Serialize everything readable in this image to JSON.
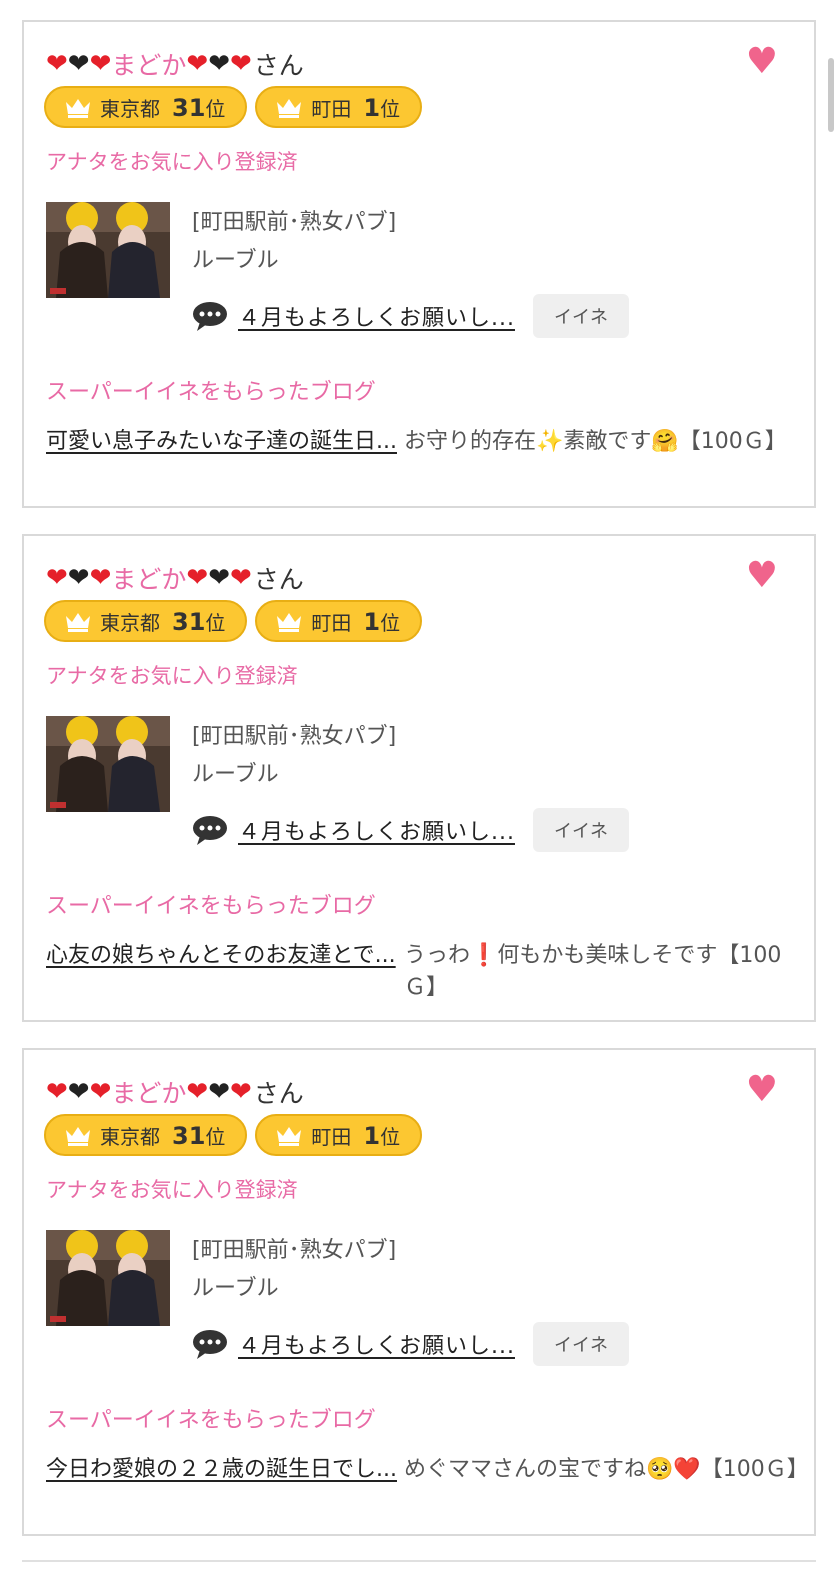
{
  "colors": {
    "accent_pink": "#e86aa5",
    "badge_yellow": "#fcc731",
    "fav_heart": "#f0648c"
  },
  "cards": [
    {
      "name": "まどか",
      "honorific": "さん",
      "fav_icon": "heart-icon",
      "badges": [
        {
          "area": "東京都",
          "rank": "31",
          "suffix": "位"
        },
        {
          "area": "町田",
          "rank": "1",
          "suffix": "位"
        }
      ],
      "fav_status": "アナタをお気に入り登録済",
      "shop_category": "[町田駅前･熟女パブ]",
      "shop_name": "ルーブル",
      "comment": "４月もよろしくお願いし...",
      "iine_label": "イイネ",
      "blog_heading": "スーパーイイネをもらったブログ",
      "blog_title": "可愛い息子みたいな子達の誕生日...",
      "blog_comment": "お守り的存在✨素敵です🤗【100Ｇ】"
    },
    {
      "name": "まどか",
      "honorific": "さん",
      "fav_icon": "heart-icon",
      "badges": [
        {
          "area": "東京都",
          "rank": "31",
          "suffix": "位"
        },
        {
          "area": "町田",
          "rank": "1",
          "suffix": "位"
        }
      ],
      "fav_status": "アナタをお気に入り登録済",
      "shop_category": "[町田駅前･熟女パブ]",
      "shop_name": "ルーブル",
      "comment": "４月もよろしくお願いし...",
      "iine_label": "イイネ",
      "blog_heading": "スーパーイイネをもらったブログ",
      "blog_title": "心友の娘ちゃんとそのお友達とで...",
      "blog_comment": "うっわ❗何もかも美味しそです【100Ｇ】"
    },
    {
      "name": "まどか",
      "honorific": "さん",
      "fav_icon": "heart-icon",
      "badges": [
        {
          "area": "東京都",
          "rank": "31",
          "suffix": "位"
        },
        {
          "area": "町田",
          "rank": "1",
          "suffix": "位"
        }
      ],
      "fav_status": "アナタをお気に入り登録済",
      "shop_category": "[町田駅前･熟女パブ]",
      "shop_name": "ルーブル",
      "comment": "４月もよろしくお願いし...",
      "iine_label": "イイネ",
      "blog_heading": "スーパーイイネをもらったブログ",
      "blog_title": "今日わ愛娘の２２歳の誕生日でし...",
      "blog_comment": "めぐママさんの宝ですね🥺❤️【100Ｇ】"
    }
  ]
}
